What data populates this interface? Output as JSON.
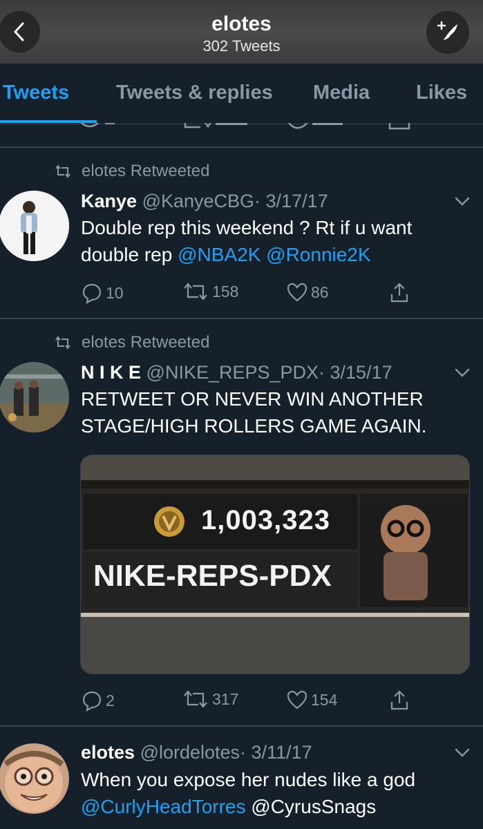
{
  "header": {
    "title": "elotes",
    "subtitle": "302 Tweets",
    "back_icon": "chevron-left-icon",
    "compose_icon": "compose-feather-icon"
  },
  "tabs": [
    {
      "label": "Tweets",
      "active": true
    },
    {
      "label": "Tweets & replies",
      "active": false
    },
    {
      "label": "Media",
      "active": false
    },
    {
      "label": "Likes",
      "active": false
    }
  ],
  "tweets": [
    {
      "retweeted_by": "elotes Retweeted",
      "name": "Kanye",
      "handle": "@KanyeCBG",
      "date": "· 3/17/17",
      "text_plain": "Double rep this weekend ? Rt if u want",
      "text_line2": "double rep",
      "mentions": [
        "@NBA2K",
        "@Ronnie2K"
      ],
      "replies": "10",
      "retweets": "158",
      "likes": "86"
    },
    {
      "retweeted_by": "elotes Retweeted",
      "name": "N I K E",
      "handle": "@NIKE_REPS_PDX",
      "date": "· 3/15/17",
      "text_line1": "RETWEET OR NEVER WIN ANOTHER",
      "text_line2": "STAGE/HIGH ROLLERS GAME AGAIN.",
      "media": {
        "amount": "1,003,323",
        "player": "NIKE-REPS-PDX"
      },
      "replies": "2",
      "retweets": "317",
      "likes": "154"
    },
    {
      "name": "elotes",
      "handle": "@lordelotes",
      "date": "· 3/11/17",
      "text_line1": "When you expose her nudes like a god",
      "mentions": [
        "@CurlyHeadTorres",
        "@CyrusSnags"
      ]
    }
  ],
  "colors": {
    "background": "#15202b",
    "accent": "#1da1f2",
    "muted": "#8899a6",
    "divider": "#38444d"
  }
}
